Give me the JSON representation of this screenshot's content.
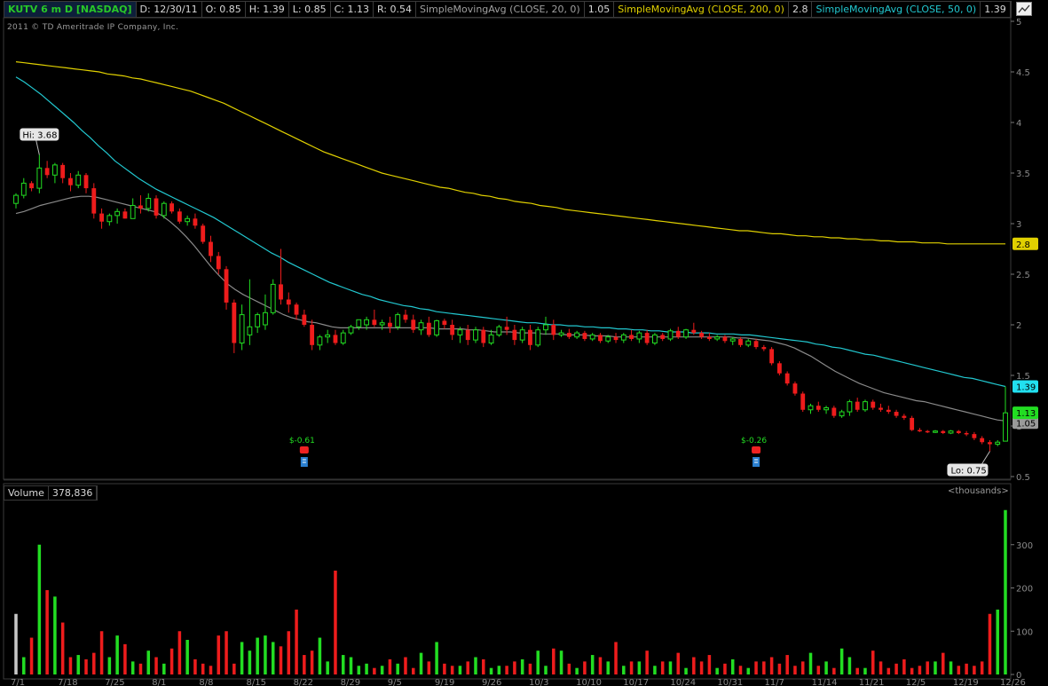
{
  "header": {
    "symbol": "KUTV 6 m D [NASDAQ]",
    "date": "D: 12/30/11",
    "open": "O: 0.85",
    "high": "H: 1.39",
    "low": "L: 0.85",
    "close": "C: 1.13",
    "range": "R: 0.54",
    "sma20_label": "SimpleMovingAvg (CLOSE, 20, 0)",
    "sma20_value": "1.05",
    "sma200_label": "SimpleMovingAvg (CLOSE, 200, 0)",
    "sma200_value": "2.8",
    "sma50_label": "SimpleMovingAvg (CLOSE, 50, 0)",
    "sma50_value": "1.39"
  },
  "copyright": "2011 © TD Ameritrade IP Company, Inc.",
  "volume_header": {
    "label": "Volume",
    "value": "378,836",
    "unit": "<thousands>"
  },
  "colors": {
    "up": "#22dd22",
    "down": "#ee1c1c",
    "neutral": "#c8c8c8",
    "sma20": "#8a8a8a",
    "sma50": "#22c8d0",
    "sma200": "#e0d000",
    "grid": "#2a2a2a"
  },
  "chart_data": [
    {
      "type": "candlestick",
      "title": "KUTV 6 m D [NASDAQ]",
      "ylim": [
        0.5,
        5
      ],
      "yticks": [
        0.5,
        1,
        1.5,
        2,
        2.5,
        3,
        3.5,
        4,
        4.5,
        5
      ],
      "x_tick_labels": [
        "7/1",
        "7/18",
        "7/25",
        "8/1",
        "8/8",
        "8/15",
        "8/22",
        "8/29",
        "9/5",
        "9/19",
        "9/26",
        "10/3",
        "10/10",
        "10/17",
        "10/24",
        "10/31",
        "11/7",
        "11/14",
        "11/21",
        "12/5",
        "12/19",
        "12/26"
      ],
      "annotations": {
        "high": {
          "label": "Hi: 3.68",
          "value": 3.68,
          "index": 3
        },
        "low": {
          "label": "Lo: 0.75",
          "value": 0.75,
          "index": 125
        },
        "dividends": [
          {
            "label": "$-0.61",
            "index": 37
          },
          {
            "label": "$-0.26",
            "index": 95
          }
        ]
      },
      "last_labels": {
        "sma200": "2.8",
        "sma50": "1.39",
        "close": "1.13",
        "sma20": "1.05"
      },
      "candles": [
        [
          3.2,
          3.3,
          3.15,
          3.28
        ],
        [
          3.28,
          3.45,
          3.25,
          3.4
        ],
        [
          3.4,
          3.42,
          3.32,
          3.35
        ],
        [
          3.35,
          3.68,
          3.3,
          3.55
        ],
        [
          3.55,
          3.62,
          3.45,
          3.48
        ],
        [
          3.48,
          3.6,
          3.4,
          3.58
        ],
        [
          3.58,
          3.6,
          3.4,
          3.45
        ],
        [
          3.45,
          3.5,
          3.32,
          3.38
        ],
        [
          3.38,
          3.52,
          3.35,
          3.48
        ],
        [
          3.48,
          3.5,
          3.3,
          3.35
        ],
        [
          3.35,
          3.4,
          3.05,
          3.1
        ],
        [
          3.1,
          3.15,
          2.95,
          3.02
        ],
        [
          3.02,
          3.1,
          2.98,
          3.08
        ],
        [
          3.08,
          3.15,
          3.0,
          3.12
        ],
        [
          3.12,
          3.15,
          3.05,
          3.05
        ],
        [
          3.05,
          3.25,
          3.05,
          3.18
        ],
        [
          3.18,
          3.28,
          3.1,
          3.15
        ],
        [
          3.15,
          3.3,
          3.12,
          3.25
        ],
        [
          3.25,
          3.28,
          3.05,
          3.08
        ],
        [
          3.08,
          3.22,
          3.05,
          3.2
        ],
        [
          3.2,
          3.22,
          3.1,
          3.12
        ],
        [
          3.12,
          3.15,
          3.0,
          3.02
        ],
        [
          3.02,
          3.08,
          2.98,
          3.05
        ],
        [
          3.05,
          3.1,
          2.95,
          2.98
        ],
        [
          2.98,
          3.0,
          2.8,
          2.82
        ],
        [
          2.82,
          2.88,
          2.62,
          2.68
        ],
        [
          2.68,
          2.72,
          2.5,
          2.55
        ],
        [
          2.55,
          2.58,
          2.15,
          2.22
        ],
        [
          2.22,
          2.25,
          1.72,
          1.82
        ],
        [
          1.82,
          2.2,
          1.75,
          2.1
        ],
        [
          1.9,
          2.45,
          1.8,
          1.98
        ],
        [
          1.98,
          2.12,
          1.92,
          2.1
        ],
        [
          2.0,
          2.3,
          1.95,
          2.12
        ],
        [
          2.12,
          2.45,
          2.1,
          2.4
        ],
        [
          2.4,
          2.75,
          2.2,
          2.25
        ],
        [
          2.25,
          2.32,
          2.12,
          2.2
        ],
        [
          2.2,
          2.22,
          2.05,
          2.1
        ],
        [
          2.1,
          2.15,
          1.98,
          2.0
        ],
        [
          2.0,
          2.05,
          1.75,
          1.8
        ],
        [
          1.8,
          1.9,
          1.75,
          1.88
        ],
        [
          1.88,
          1.95,
          1.82,
          1.9
        ],
        [
          1.9,
          1.95,
          1.8,
          1.82
        ],
        [
          1.82,
          1.95,
          1.8,
          1.92
        ],
        [
          1.92,
          2.0,
          1.9,
          1.98
        ],
        [
          1.98,
          2.05,
          1.95,
          2.05
        ],
        [
          2.0,
          2.08,
          1.95,
          2.05
        ],
        [
          2.05,
          2.15,
          1.98,
          2.0
        ],
        [
          2.0,
          2.05,
          1.95,
          2.02
        ],
        [
          2.02,
          2.08,
          1.92,
          1.98
        ],
        [
          1.98,
          2.12,
          1.95,
          2.1
        ],
        [
          2.1,
          2.15,
          2.02,
          2.05
        ],
        [
          2.05,
          2.1,
          1.92,
          1.95
        ],
        [
          1.95,
          2.05,
          1.9,
          2.02
        ],
        [
          2.02,
          2.08,
          1.88,
          1.9
        ],
        [
          1.9,
          2.05,
          1.88,
          2.04
        ],
        [
          2.04,
          2.06,
          1.96,
          2.0
        ],
        [
          2.0,
          2.05,
          1.85,
          1.9
        ],
        [
          1.9,
          1.98,
          1.82,
          1.95
        ],
        [
          1.95,
          2.0,
          1.8,
          1.85
        ],
        [
          1.85,
          1.98,
          1.82,
          1.95
        ],
        [
          1.95,
          1.98,
          1.78,
          1.82
        ],
        [
          1.82,
          1.95,
          1.8,
          1.9
        ],
        [
          1.9,
          2.0,
          1.88,
          1.98
        ],
        [
          1.98,
          2.08,
          1.9,
          1.95
        ],
        [
          1.95,
          2.0,
          1.8,
          1.85
        ],
        [
          1.85,
          1.98,
          1.82,
          1.95
        ],
        [
          1.95,
          2.0,
          1.75,
          1.8
        ],
        [
          1.8,
          1.98,
          1.78,
          1.95
        ],
        [
          1.95,
          2.08,
          1.9,
          2.0
        ],
        [
          2.0,
          2.05,
          1.85,
          1.9
        ],
        [
          1.9,
          1.95,
          1.88,
          1.92
        ],
        [
          1.92,
          1.96,
          1.86,
          1.88
        ],
        [
          1.88,
          1.94,
          1.86,
          1.92
        ],
        [
          1.92,
          1.94,
          1.84,
          1.86
        ],
        [
          1.86,
          1.92,
          1.84,
          1.9
        ],
        [
          1.9,
          1.92,
          1.82,
          1.84
        ],
        [
          1.84,
          1.9,
          1.82,
          1.88
        ],
        [
          1.88,
          1.92,
          1.82,
          1.85
        ],
        [
          1.85,
          1.92,
          1.82,
          1.9
        ],
        [
          1.9,
          1.95,
          1.84,
          1.86
        ],
        [
          1.86,
          1.94,
          1.82,
          1.92
        ],
        [
          1.92,
          1.95,
          1.8,
          1.82
        ],
        [
          1.82,
          1.92,
          1.8,
          1.9
        ],
        [
          1.9,
          1.92,
          1.84,
          1.86
        ],
        [
          1.86,
          1.96,
          1.84,
          1.94
        ],
        [
          1.94,
          1.98,
          1.86,
          1.88
        ],
        [
          1.88,
          1.96,
          1.86,
          1.95
        ],
        [
          1.95,
          2.02,
          1.9,
          1.92
        ],
        [
          1.92,
          1.94,
          1.86,
          1.88
        ],
        [
          1.88,
          1.92,
          1.84,
          1.86
        ],
        [
          1.86,
          1.9,
          1.84,
          1.88
        ],
        [
          1.88,
          1.9,
          1.82,
          1.84
        ],
        [
          1.84,
          1.88,
          1.8,
          1.86
        ],
        [
          1.86,
          1.88,
          1.78,
          1.8
        ],
        [
          1.8,
          1.86,
          1.78,
          1.84
        ],
        [
          1.84,
          1.86,
          1.76,
          1.78
        ],
        [
          1.78,
          1.8,
          1.74,
          1.76
        ],
        [
          1.76,
          1.78,
          1.6,
          1.62
        ],
        [
          1.62,
          1.64,
          1.5,
          1.52
        ],
        [
          1.52,
          1.54,
          1.4,
          1.42
        ],
        [
          1.42,
          1.44,
          1.3,
          1.32
        ],
        [
          1.32,
          1.34,
          1.14,
          1.16
        ],
        [
          1.16,
          1.22,
          1.12,
          1.2
        ],
        [
          1.2,
          1.24,
          1.14,
          1.16
        ],
        [
          1.16,
          1.2,
          1.12,
          1.18
        ],
        [
          1.18,
          1.2,
          1.08,
          1.1
        ],
        [
          1.1,
          1.16,
          1.08,
          1.14
        ],
        [
          1.14,
          1.26,
          1.1,
          1.24
        ],
        [
          1.24,
          1.28,
          1.14,
          1.16
        ],
        [
          1.16,
          1.26,
          1.14,
          1.24
        ],
        [
          1.24,
          1.26,
          1.16,
          1.18
        ],
        [
          1.18,
          1.22,
          1.14,
          1.16
        ],
        [
          1.16,
          1.2,
          1.12,
          1.14
        ],
        [
          1.14,
          1.16,
          1.08,
          1.1
        ],
        [
          1.1,
          1.12,
          1.06,
          1.08
        ],
        [
          1.08,
          1.1,
          0.95,
          0.96
        ],
        [
          0.96,
          0.98,
          0.94,
          0.95
        ],
        [
          0.95,
          0.96,
          0.93,
          0.94
        ],
        [
          0.94,
          0.96,
          0.93,
          0.95
        ],
        [
          0.95,
          0.96,
          0.92,
          0.93
        ],
        [
          0.93,
          0.96,
          0.92,
          0.95
        ],
        [
          0.95,
          0.96,
          0.92,
          0.93
        ],
        [
          0.93,
          0.95,
          0.9,
          0.92
        ],
        [
          0.92,
          0.94,
          0.86,
          0.88
        ],
        [
          0.88,
          0.9,
          0.82,
          0.84
        ],
        [
          0.84,
          0.86,
          0.75,
          0.82
        ],
        [
          0.82,
          0.86,
          0.8,
          0.84
        ],
        [
          0.85,
          1.39,
          0.85,
          1.13
        ]
      ],
      "sma20": [
        3.1,
        3.12,
        3.15,
        3.18,
        3.2,
        3.22,
        3.24,
        3.26,
        3.27,
        3.27,
        3.26,
        3.24,
        3.22,
        3.2,
        3.18,
        3.16,
        3.14,
        3.12,
        3.08,
        3.02,
        2.95,
        2.87,
        2.78,
        2.68,
        2.58,
        2.49,
        2.41,
        2.35,
        2.3,
        2.26,
        2.22,
        2.18,
        2.14,
        2.1,
        2.07,
        2.05,
        2.03,
        2.02,
        2.0,
        1.98,
        1.97,
        1.97,
        1.97,
        1.97,
        1.97,
        1.97,
        1.97,
        1.97,
        1.97,
        1.97,
        1.97,
        1.97,
        1.96,
        1.96,
        1.96,
        1.96,
        1.95,
        1.95,
        1.94,
        1.93,
        1.93,
        1.93,
        1.92,
        1.92,
        1.92,
        1.91,
        1.91,
        1.91,
        1.9,
        1.9,
        1.9,
        1.89,
        1.89,
        1.89,
        1.88,
        1.88,
        1.88,
        1.88,
        1.88,
        1.88,
        1.88,
        1.88,
        1.88,
        1.88,
        1.88,
        1.88,
        1.88,
        1.88,
        1.88,
        1.87,
        1.87,
        1.86,
        1.85,
        1.84,
        1.82,
        1.8,
        1.77,
        1.73,
        1.69,
        1.64,
        1.59,
        1.54,
        1.5,
        1.46,
        1.42,
        1.39,
        1.36,
        1.33,
        1.31,
        1.29,
        1.27,
        1.25,
        1.24,
        1.22,
        1.2,
        1.18,
        1.16,
        1.14,
        1.12,
        1.1,
        1.08,
        1.06,
        1.05
      ],
      "sma50": [
        4.45,
        4.4,
        4.34,
        4.28,
        4.21,
        4.14,
        4.07,
        4.0,
        3.92,
        3.85,
        3.77,
        3.7,
        3.62,
        3.56,
        3.5,
        3.44,
        3.39,
        3.34,
        3.3,
        3.26,
        3.22,
        3.18,
        3.14,
        3.1,
        3.06,
        3.01,
        2.96,
        2.91,
        2.86,
        2.81,
        2.76,
        2.71,
        2.67,
        2.62,
        2.58,
        2.54,
        2.5,
        2.46,
        2.42,
        2.39,
        2.36,
        2.33,
        2.3,
        2.28,
        2.25,
        2.23,
        2.21,
        2.19,
        2.18,
        2.16,
        2.15,
        2.13,
        2.12,
        2.11,
        2.1,
        2.09,
        2.08,
        2.07,
        2.06,
        2.05,
        2.04,
        2.03,
        2.02,
        2.02,
        2.01,
        2.0,
        2.0,
        1.99,
        1.99,
        1.98,
        1.98,
        1.97,
        1.97,
        1.96,
        1.96,
        1.95,
        1.95,
        1.94,
        1.94,
        1.93,
        1.93,
        1.93,
        1.92,
        1.92,
        1.92,
        1.91,
        1.91,
        1.91,
        1.9,
        1.9,
        1.89,
        1.88,
        1.87,
        1.86,
        1.85,
        1.84,
        1.83,
        1.81,
        1.8,
        1.78,
        1.77,
        1.75,
        1.73,
        1.71,
        1.7,
        1.68,
        1.66,
        1.64,
        1.62,
        1.6,
        1.58,
        1.56,
        1.54,
        1.52,
        1.5,
        1.48,
        1.47,
        1.45,
        1.43,
        1.41,
        1.39
      ],
      "sma200": [
        4.6,
        4.59,
        4.58,
        4.57,
        4.56,
        4.55,
        4.54,
        4.53,
        4.52,
        4.51,
        4.5,
        4.48,
        4.47,
        4.46,
        4.44,
        4.43,
        4.41,
        4.39,
        4.37,
        4.35,
        4.33,
        4.31,
        4.28,
        4.25,
        4.22,
        4.19,
        4.15,
        4.11,
        4.07,
        4.03,
        3.99,
        3.95,
        3.91,
        3.87,
        3.83,
        3.79,
        3.75,
        3.71,
        3.68,
        3.65,
        3.62,
        3.59,
        3.56,
        3.53,
        3.5,
        3.48,
        3.46,
        3.44,
        3.42,
        3.4,
        3.38,
        3.36,
        3.35,
        3.33,
        3.31,
        3.3,
        3.28,
        3.27,
        3.25,
        3.24,
        3.22,
        3.21,
        3.2,
        3.18,
        3.17,
        3.16,
        3.14,
        3.13,
        3.12,
        3.11,
        3.1,
        3.09,
        3.08,
        3.07,
        3.06,
        3.05,
        3.04,
        3.03,
        3.02,
        3.01,
        3.0,
        2.99,
        2.98,
        2.97,
        2.96,
        2.95,
        2.94,
        2.93,
        2.93,
        2.92,
        2.91,
        2.9,
        2.9,
        2.89,
        2.88,
        2.88,
        2.87,
        2.87,
        2.86,
        2.86,
        2.85,
        2.85,
        2.84,
        2.84,
        2.83,
        2.83,
        2.82,
        2.82,
        2.82,
        2.81,
        2.81,
        2.81,
        2.8,
        2.8,
        2.8,
        2.8,
        2.8,
        2.8,
        2.8,
        2.8
      ]
    },
    {
      "type": "bar",
      "title": "Volume",
      "ylabel": "<thousands>",
      "ylim": [
        0,
        400
      ],
      "yticks": [
        0,
        100,
        200,
        300
      ],
      "values": [
        140,
        40,
        85,
        300,
        195,
        180,
        120,
        40,
        45,
        35,
        50,
        100,
        40,
        90,
        70,
        30,
        25,
        55,
        40,
        25,
        60,
        100,
        80,
        35,
        25,
        20,
        90,
        100,
        25,
        75,
        55,
        85,
        90,
        75,
        65,
        100,
        150,
        45,
        55,
        85,
        30,
        240,
        45,
        40,
        20,
        25,
        15,
        20,
        35,
        25,
        40,
        15,
        50,
        30,
        75,
        25,
        20,
        20,
        30,
        40,
        35,
        15,
        20,
        20,
        30,
        35,
        25,
        55,
        20,
        60,
        55,
        25,
        15,
        30,
        45,
        40,
        30,
        75,
        20,
        30,
        30,
        55,
        20,
        30,
        30,
        50,
        15,
        40,
        30,
        45,
        15,
        25,
        35,
        20,
        15,
        30,
        30,
        40,
        25,
        45,
        20,
        30,
        50,
        20,
        30,
        15,
        60,
        40,
        15,
        15,
        55,
        30,
        15,
        25,
        35,
        15,
        20,
        30,
        30,
        50,
        30,
        20,
        25,
        20,
        30,
        140,
        150,
        380
      ],
      "colors": "by_candle"
    }
  ]
}
